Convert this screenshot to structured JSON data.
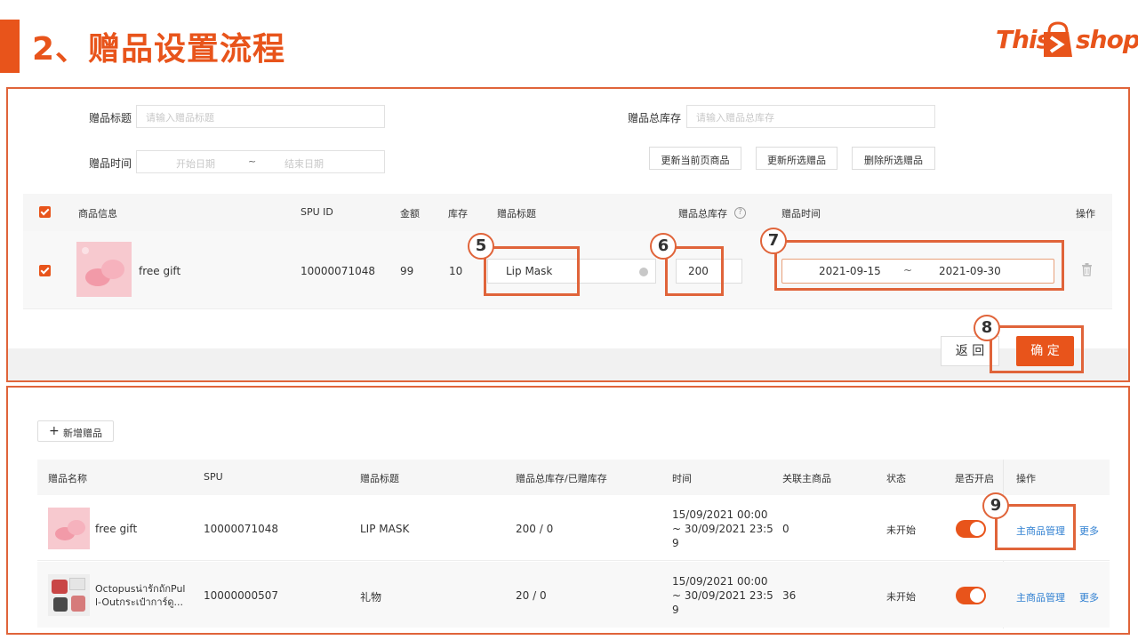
{
  "slide": {
    "title": "2、赠品设置流程"
  },
  "logo": {
    "text_left": "This",
    "text_right": "shop"
  },
  "edit_form": {
    "title_label": "赠品标题",
    "title_placeholder": "请输入赠品标题",
    "stock_label": "赠品总库存",
    "stock_placeholder": "请输入赠品总库存",
    "time_label": "赠品时间",
    "start_placeholder": "开始日期",
    "end_placeholder": "结束日期",
    "range_sep": "~",
    "buttons": {
      "update_page": "更新当前页商品",
      "update_selected": "更新所选赠品",
      "delete_selected": "删除所选赠品"
    },
    "columns": {
      "product": "商品信息",
      "spu": "SPU ID",
      "amount": "金额",
      "inventory": "库存",
      "gift_title": "赠品标题",
      "gift_stock": "赠品总库存",
      "help": "?",
      "gift_time": "赠品时间",
      "action": "操作"
    },
    "row": {
      "name": "free gift",
      "spu": "10000071048",
      "amount": "99",
      "inventory": "10",
      "gift_title": "Lip Mask",
      "gift_stock": "200",
      "start": "2021-09-15",
      "end": "2021-09-30"
    },
    "back_button": "返 回",
    "confirm_button": "确 定"
  },
  "steps": {
    "s5": "5",
    "s6": "6",
    "s7": "7",
    "s8": "8",
    "s9": "9"
  },
  "gift_list": {
    "add_button": "新增赠品",
    "columns": {
      "name": "赠品名称",
      "spu": "SPU",
      "title": "赠品标题",
      "stock": "赠品总库存/已赠库存",
      "time": "时间",
      "linked": "关联主商品",
      "status": "状态",
      "enabled": "是否开启",
      "action": "操作"
    },
    "rows": [
      {
        "name": "free gift",
        "spu": "10000071048",
        "title": "LIP MASK",
        "stock": "200 / 0",
        "time_1": "15/09/2021 00:00",
        "time_2": "~ 30/09/2021 23:5",
        "time_3": "9",
        "linked": "0",
        "status": "未开始",
        "manage": "主商品管理",
        "more": "更多"
      },
      {
        "name_1": "Octopusน่ารักถักPul",
        "name_2": "l-Outกระเป๋าการ์ดู...",
        "spu": "10000000507",
        "title": "礼物",
        "stock": "20 / 0",
        "time_1": "15/09/2021 00:00",
        "time_2": "~ 30/09/2021 23:5",
        "time_3": "9",
        "linked": "36",
        "status": "未开始",
        "manage": "主商品管理",
        "more": "更多"
      }
    ]
  },
  "colors": {
    "accent": "#e8541b",
    "link": "#2f7fd1",
    "box": "#e0643a"
  },
  "icons": {
    "plus": "plus-icon",
    "trash": "trash-icon",
    "clear": "clear-icon",
    "help": "help-icon"
  }
}
